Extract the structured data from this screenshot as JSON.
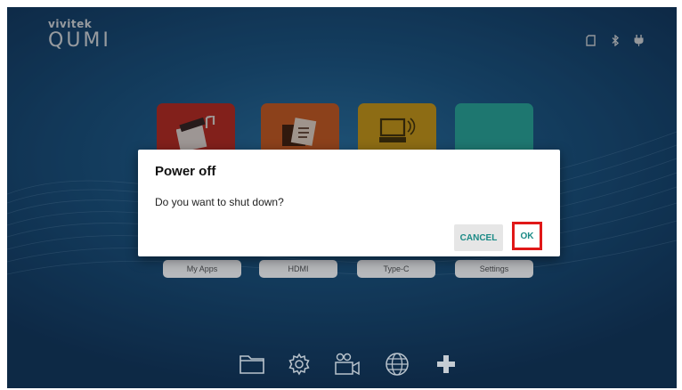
{
  "brand": {
    "maker": "vivitek",
    "model": "QUMI"
  },
  "status_icons": [
    "sd-card-icon",
    "bluetooth-icon",
    "power-plug-icon"
  ],
  "tiles": [
    {
      "label": "My Apps",
      "color": "#c8322a",
      "icon": "media-icon"
    },
    {
      "label": "HDMI",
      "color": "#d8642a",
      "icon": "files-icon"
    },
    {
      "label": "Type-C",
      "color": "#d9a71f",
      "icon": "computer-cast-icon"
    },
    {
      "label": "Settings",
      "color": "#2fb7ad",
      "icon": "settings-icon"
    }
  ],
  "dock": [
    "folder-icon",
    "gear-icon",
    "camera-icon",
    "globe-icon",
    "plus-icon"
  ],
  "dialog": {
    "title": "Power off",
    "message": "Do you want to shut down?",
    "cancel_label": "CANCEL",
    "ok_label": "OK",
    "button_color": "#1b8a86",
    "highlight_color": "#e01818"
  }
}
